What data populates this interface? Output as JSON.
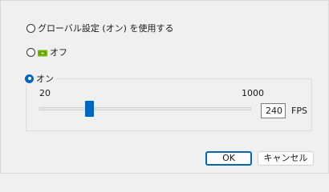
{
  "options": {
    "global": {
      "label": "グローバル設定 (オン) を使用する",
      "selected": false
    },
    "off": {
      "label": "オフ",
      "selected": false,
      "icon": "gpu-card-icon"
    },
    "on": {
      "label": "オン",
      "selected": true
    }
  },
  "slider": {
    "min_label": "20",
    "max_label": "1000",
    "min": 20,
    "max": 1000,
    "value": 240
  },
  "fps": {
    "value": "240",
    "unit": "FPS"
  },
  "buttons": {
    "ok": "OK",
    "cancel": "キャンセル"
  },
  "colors": {
    "accent": "#0067c0",
    "icon_green": "#76b900"
  }
}
